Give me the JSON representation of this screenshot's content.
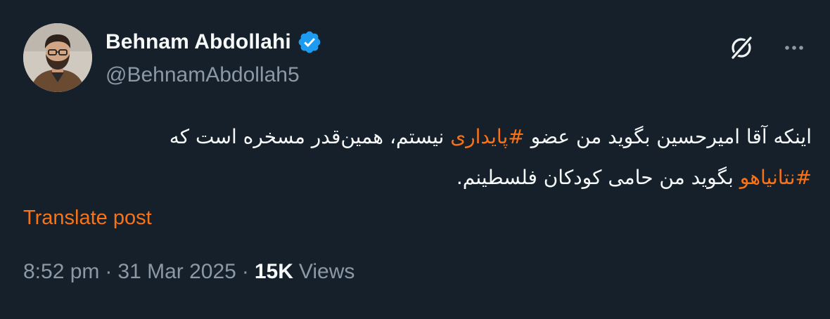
{
  "author": {
    "display_name": "Behnam Abdollahi",
    "handle": "@BehnamAbdollah5",
    "verified": true,
    "verified_color": "#1d9bf0",
    "avatar_icon": "user-avatar-photo"
  },
  "toolbar": {
    "grok_icon": "grok-icon",
    "more_icon": "more-horizontal-icon"
  },
  "tweet": {
    "line1_part1": "اینکه آقا امیرحسین بگوید من عضو ",
    "hashtag1": "#پایداری",
    "line1_part2": " نیستم، همین‌قدر مسخره است که",
    "hashtag2": "#نتانیاهو",
    "line2_part": " بگوید من حامی کودکان فلسطینم."
  },
  "translate_label": "Translate post",
  "meta": {
    "time": "8:52 pm",
    "separator": "·",
    "date": "31 Mar 2025",
    "views_count": "15K",
    "views_label": "Views"
  },
  "colors": {
    "background": "#15202b",
    "text_primary": "#f7f9f9",
    "text_secondary": "#8b98a5",
    "accent": "#f97316"
  }
}
